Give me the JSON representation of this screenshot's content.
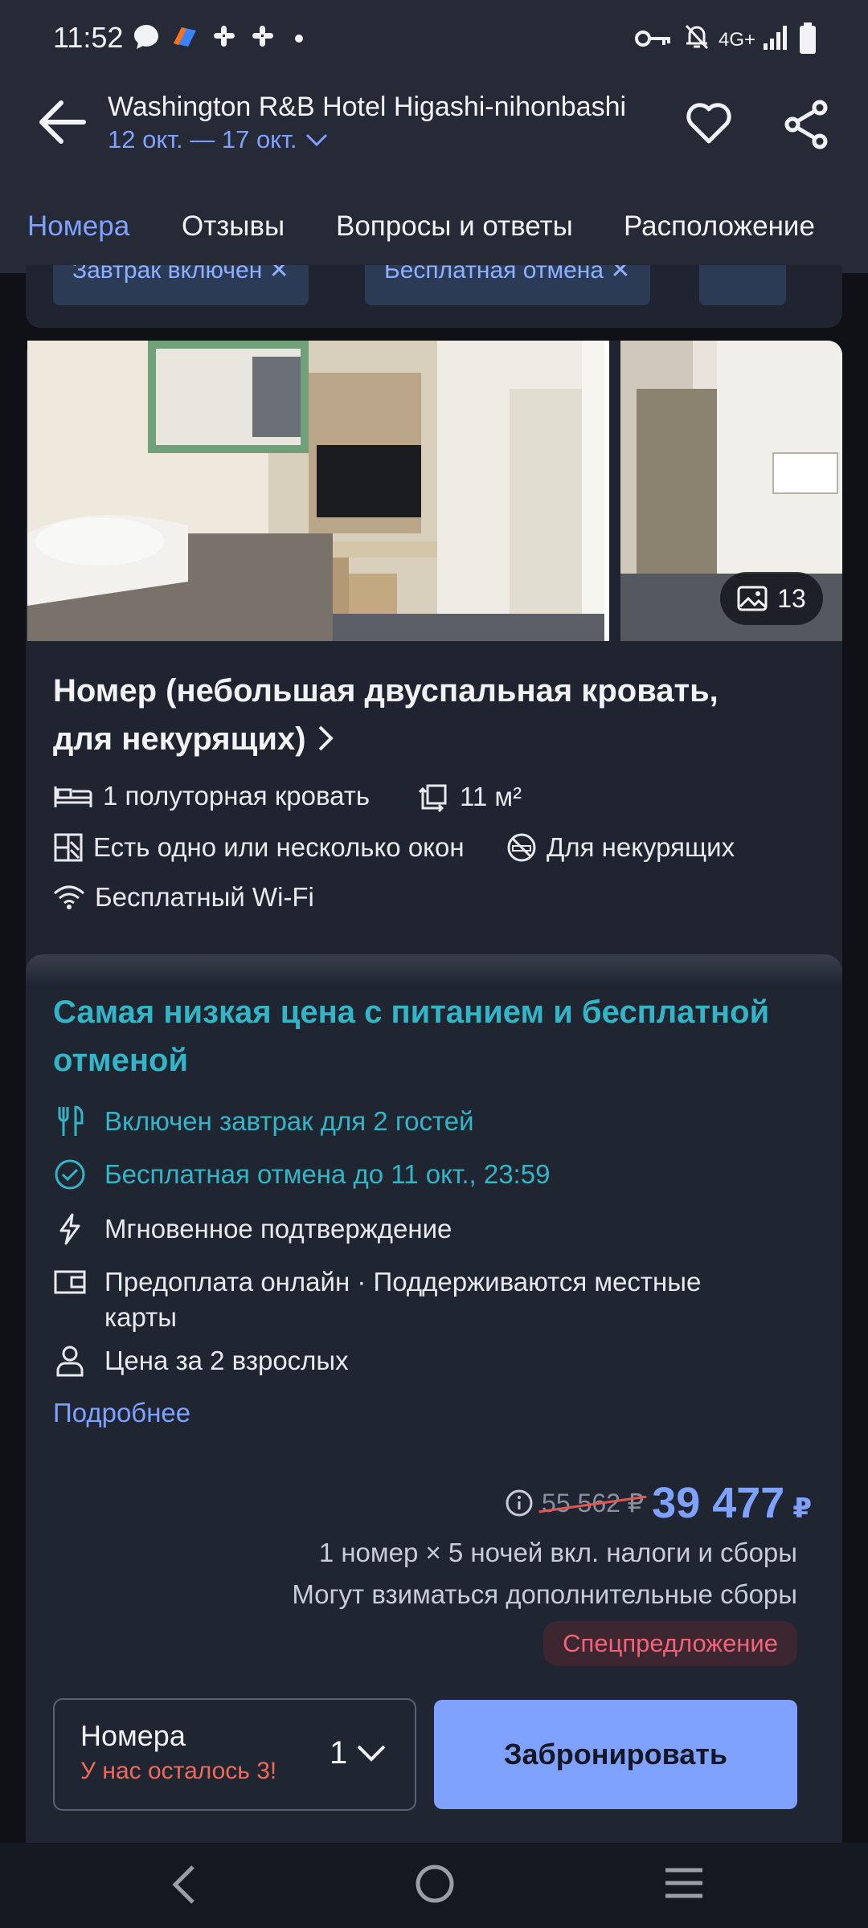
{
  "status_bar": {
    "time": "11:52",
    "network": "4G+",
    "icons": [
      "chat-icon",
      "app-icon",
      "slack-icon",
      "slack-icon",
      "dot-icon",
      "vpn-key-icon",
      "mute-bell-icon",
      "signal-icon",
      "battery-icon"
    ]
  },
  "header": {
    "hotel_name": "Washington R&B Hotel Higashi-nihonbashi",
    "dates": "12 окт. — 17 окт."
  },
  "tabs": [
    {
      "label": "Номера",
      "active": true
    },
    {
      "label": "Отзывы"
    },
    {
      "label": "Вопросы и ответы"
    },
    {
      "label": "Расположение"
    }
  ],
  "filters": [
    {
      "label": "Завтрак включен ✕"
    },
    {
      "label": "Бесплатная отмена ✕"
    }
  ],
  "room": {
    "photo_count": "13",
    "title": "Номер (небольшая двуспальная кровать, для некурящих)",
    "features": {
      "bed": "1 полуторная кровать",
      "area": "11 м²",
      "windows": "Есть одно или несколько окон",
      "smoking": "Для некурящих",
      "wifi": "Бесплатный Wi-Fi"
    }
  },
  "offer": {
    "title": "Самая низкая цена с питанием и бесплатной отменой",
    "perks": {
      "breakfast": "Включен завтрак для 2 гостей",
      "cancel": "Бесплатная отмена до 11 окт., 23:59",
      "instant": "Мгновенное подтверждение",
      "prepay": "Предоплата онлайн · Поддерживаются местные карты",
      "guests": "Цена за 2 взрослых"
    },
    "more_link": "Подробнее",
    "old_price": "55 562 ₽",
    "price": "39 477",
    "currency": "₽",
    "price_note_1": "1 номер × 5 ночей вкл. налоги и сборы",
    "price_note_2": "Могут взиматься дополнительные сборы",
    "badge": "Спецпредложение",
    "rooms_label": "Номера",
    "rooms_left": "У нас осталось 3!",
    "rooms_count": "1",
    "book_label": "Забронировать"
  },
  "colors": {
    "accent": "#7fa1ff",
    "teal": "#33b5c8",
    "warning": "#f06a5c",
    "background": "#1f2430"
  }
}
